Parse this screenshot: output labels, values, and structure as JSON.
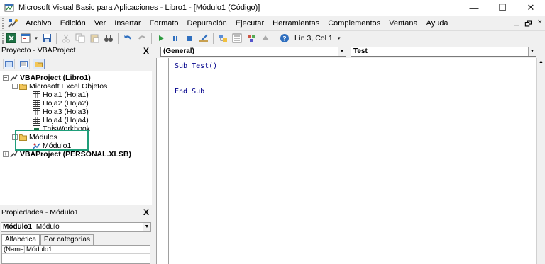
{
  "window": {
    "title": "Microsoft Visual Basic para Aplicaciones - Libro1 - [Módulo1 (Código)]",
    "minimize_label": "—",
    "maximize_label": "☐",
    "close_label": "✕"
  },
  "menubar": {
    "items": [
      {
        "label": "Archivo"
      },
      {
        "label": "Edición"
      },
      {
        "label": "Ver"
      },
      {
        "label": "Insertar"
      },
      {
        "label": "Formato"
      },
      {
        "label": "Depuración"
      },
      {
        "label": "Ejecutar"
      },
      {
        "label": "Herramientas"
      },
      {
        "label": "Complementos"
      },
      {
        "label": "Ventana"
      },
      {
        "label": "Ayuda"
      }
    ],
    "mdi_minimize": "_",
    "mdi_restore": "🗗",
    "mdi_close": "×"
  },
  "toolbar": {
    "position_status": "Lín 3, Col 1"
  },
  "project_pane": {
    "title": "Proyecto - VBAProject",
    "close_label": "X",
    "tree": [
      {
        "label": "VBAProject (Libro1)"
      },
      {
        "label": "Microsoft Excel Objetos"
      },
      {
        "label": "Hoja1 (Hoja1)"
      },
      {
        "label": "Hoja2 (Hoja2)"
      },
      {
        "label": "Hoja3 (Hoja3)"
      },
      {
        "label": "Hoja4 (Hoja4)"
      },
      {
        "label": "ThisWorkbook"
      },
      {
        "label": "Módulos"
      },
      {
        "label": "Módulo1"
      },
      {
        "label": "VBAProject (PERSONAL.XLSB)"
      }
    ]
  },
  "properties_pane": {
    "title": "Propiedades - Módulo1",
    "close_label": "X",
    "object_name": "Módulo1",
    "object_type": "Módulo",
    "tabs": [
      "Alfabética",
      "Por categorías"
    ],
    "rows": [
      {
        "name": "(Name)",
        "value": "Módulo1"
      }
    ]
  },
  "code_window": {
    "object_combo": "(General)",
    "procedure_combo": "Test",
    "lines": [
      "Sub Test()",
      "",
      "End Sub"
    ]
  },
  "colors": {
    "highlight_box": "#1f9e7a",
    "code_keyword": "#00008b"
  }
}
